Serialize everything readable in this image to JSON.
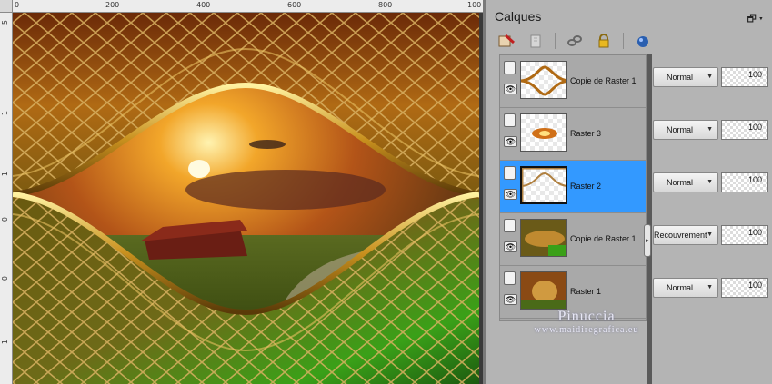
{
  "ruler": {
    "top_labels": [
      "0",
      "200",
      "400",
      "600",
      "800",
      "100"
    ],
    "left_labels": [
      "5",
      "1",
      "1",
      "0",
      "0",
      "1"
    ]
  },
  "panel": {
    "title": "Calques",
    "menu_glyph": "🗗 ▾"
  },
  "toolbar": {
    "icons": [
      "paint-layer-icon",
      "document-layer-icon",
      "link-icon",
      "lock-icon",
      "mask-icon"
    ]
  },
  "layers": [
    {
      "name": "Copie de Raster 1",
      "blend": "Normal",
      "opacity": "100",
      "selected": false
    },
    {
      "name": "Raster 3",
      "blend": "Normal",
      "opacity": "100",
      "selected": false
    },
    {
      "name": "Raster 2",
      "blend": "Normal",
      "opacity": "100",
      "selected": true
    },
    {
      "name": "Copie de Raster 1",
      "blend": "Recouvrement",
      "opacity": "100",
      "selected": false
    },
    {
      "name": "Raster 1",
      "blend": "Normal",
      "opacity": "100",
      "selected": false
    }
  ],
  "watermark": {
    "name": "Pinuccia",
    "url": "www.maidiregrafica.eu"
  },
  "colors": {
    "selected": "#3399ff",
    "panel_bg": "#b4b4b4"
  }
}
